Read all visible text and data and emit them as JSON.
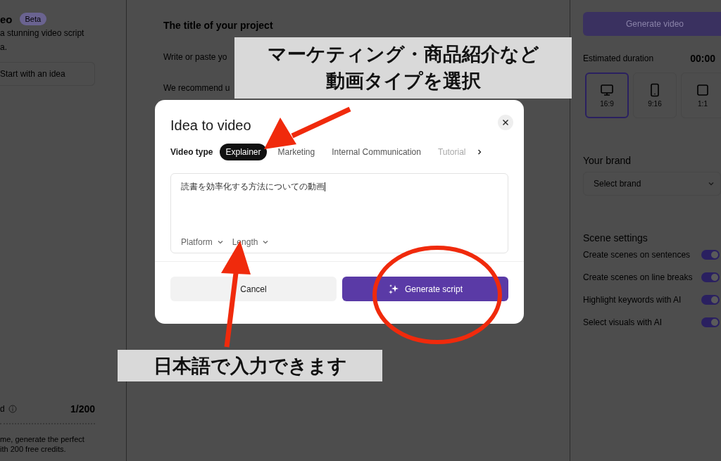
{
  "left_panel": {
    "title": "eo",
    "badge": "Beta",
    "description": [
      "a stunning video script",
      "a."
    ],
    "start_button": "Start with an idea",
    "credits_label": "d",
    "credits_count": "1/200",
    "footer": [
      "me, generate the perfect",
      "ith 200 free credits."
    ]
  },
  "editor": {
    "title_placeholder": "The title of your project",
    "body_placeholder": "Write or paste yo",
    "hint": "We recommend u"
  },
  "right_panel": {
    "generate_button": "Generate video",
    "duration_label": "Estimated duration",
    "duration": "00:00",
    "aspect_ratios": [
      {
        "label": "16:9",
        "kind": "landscape",
        "selected": true
      },
      {
        "label": "9:16",
        "kind": "portrait",
        "selected": false
      },
      {
        "label": "1:1",
        "kind": "square",
        "selected": false
      }
    ],
    "brand_heading": "Your brand",
    "brand_select": "Select brand",
    "scene_heading": "Scene settings",
    "scene_settings": [
      {
        "label": "Create scenes on sentences",
        "on": true
      },
      {
        "label": "Create scenes on line breaks",
        "on": true
      },
      {
        "label": "Highlight keywords with AI",
        "on": true
      },
      {
        "label": "Select visuals with AI",
        "on": true
      }
    ]
  },
  "dialog": {
    "title": "Idea to video",
    "video_type_label": "Video type",
    "video_types": [
      {
        "label": "Explainer",
        "selected": true
      },
      {
        "label": "Marketing",
        "selected": false
      },
      {
        "label": "Internal Communication",
        "selected": false
      },
      {
        "label": "Tutorial",
        "selected": false
      }
    ],
    "prompt_value": "読書を効率化する方法についての動画",
    "platform": "Platform",
    "length": "Length",
    "cancel": "Cancel",
    "generate": "Generate script"
  },
  "annotations": [
    {
      "kind": "callout",
      "lines": [
        "マーケティング・商品紹介など",
        "動画タイプを選択"
      ]
    },
    {
      "kind": "callout",
      "lines": [
        "日本語で入力できます"
      ]
    }
  ]
}
